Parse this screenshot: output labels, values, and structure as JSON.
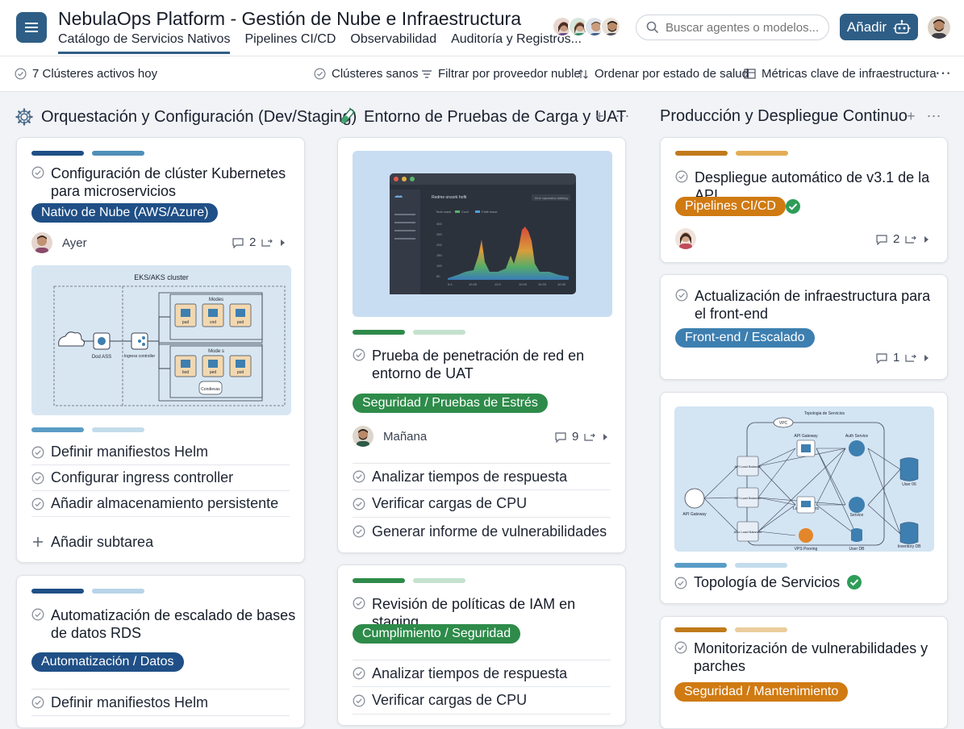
{
  "header": {
    "title": "NebulaOps Platform - Gestión de Nube e Infraestructura",
    "tabs": [
      "Catálogo de Servicios Nativos",
      "Pipelines CI/CD",
      "Observabilidad",
      "Auditoría y Registros..."
    ],
    "search_placeholder": "Buscar agentes o modelos...",
    "add_label": "Añadir"
  },
  "toolbar": {
    "active_clusters": "7 Clústeres activos hoy",
    "healthy": "Clústeres sanos",
    "filter": "Filtrar por proveedor nuble",
    "sort": "Ordenar por estado de salud",
    "metrics": "Métricas clave de infraestructura"
  },
  "columns": [
    {
      "title": "Orquestación y Configuración (Dev/Staging)",
      "cards": [
        {
          "title": "Configuración de clúster Kubernetes para microservicios",
          "tag": "Nativo de Nube (AWS/Azure)",
          "date": "Ayer",
          "comments": "2",
          "diagram": {
            "title": "EKS/AKS cluster",
            "lb": "Dod ASS",
            "ingress": "Ingress controller",
            "group1": "Modes",
            "group2": "Mode s",
            "pods1": [
              "pud",
              "cnd",
              "pod"
            ],
            "pods2": [
              "bod",
              "ped",
              "pod"
            ],
            "storage": "Condievas"
          },
          "subtasks": [
            "Definir manifiestos Helm",
            "Configurar ingress controller",
            "Añadir almacenamiento persistente"
          ],
          "add_subtask": "Añadir subtarea"
        },
        {
          "title": "Automatización de escalado de bases de datos RDS",
          "tag": "Automatización / Datos",
          "subtasks": [
            "Definir manifiestos Helm"
          ]
        }
      ]
    },
    {
      "title": "Entorno de Pruebas de Carga y UAT",
      "cards": [
        {
          "title": "Prueba de penetración de red en entorno de UAT",
          "tag": "Seguridad / Pruebas de Estrés",
          "date": "Mañana",
          "comments": "9",
          "dashboard": {
            "title": "Redme onsork hofti",
            "legend": [
              "Touit mank",
              "Cocil",
              "Fatlit mase"
            ],
            "dropdown": "Ifme vaparatus dattitag",
            "yticks": [
              "300",
              "250",
              "200",
              "150",
              "100",
              "50"
            ],
            "xticks": [
              "0:4",
              "10:45",
              "12:0",
              "10:00",
              "10:33",
              "10:30"
            ]
          },
          "subtasks": [
            "Analizar tiempos de respuesta",
            "Verificar cargas de CPU",
            "Generar informe de vulnerabilidades"
          ]
        },
        {
          "title": "Revisión de políticas de IAM en staging",
          "tag": "Cumplimiento / Seguridad",
          "subtasks": [
            "Analizar tiempos de respuesta",
            "Verificar cargas de CPU"
          ]
        }
      ]
    },
    {
      "title": "Producción y Despliegue Continuo",
      "cards": [
        {
          "title": "Despliegue automático de v3.1 de la API",
          "tag": "Pipelines CI/CD",
          "comments": "2"
        },
        {
          "title": "Actualización de infraestructura para el front-end",
          "tag": "Front-end / Escalado",
          "comments": "1"
        },
        {
          "title": "Topología de Servicios",
          "topology": {
            "title": "Topologia de Servicios",
            "vpc": "VPC",
            "gateway_left": "API Gateway",
            "gateway_top": "API Gateway",
            "auth": "Auth Service",
            "service": "Service",
            "lb": "Load Balncers",
            "vps": "VPS Pooring",
            "db1": "User 06",
            "db2": "Inventory DB",
            "db3": "User DB",
            "nodes": [
              "API Load Balancer",
              "API Load Balancer",
              "Also Load Balancer"
            ]
          }
        },
        {
          "title": "Monitorización de vulnerabilidades y parches",
          "tag": "Seguridad / Mantenimiento"
        }
      ]
    }
  ],
  "colors": {
    "primary": "#2e5e86",
    "navy_tag": "#1f4f86",
    "blue_tag": "#3d7fb0",
    "green_tag": "#2e8b4a",
    "orange_tag": "#d07a12",
    "green_check": "#2e9d58"
  }
}
